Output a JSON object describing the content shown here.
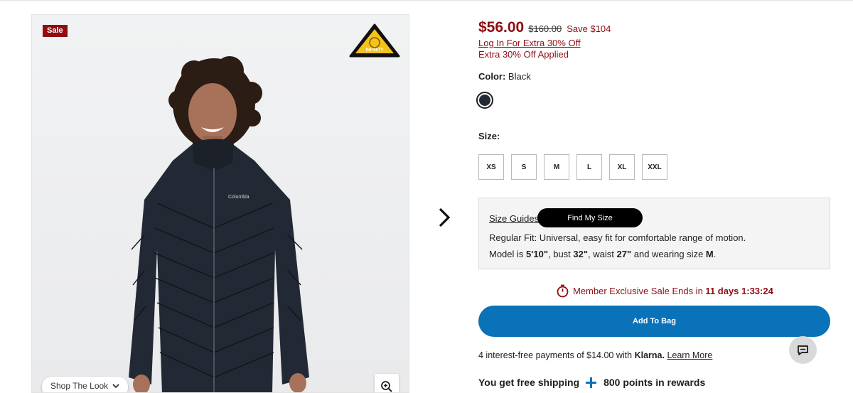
{
  "product_image": {
    "sale_badge": "Sale",
    "tech_badge": "INFINITY",
    "shop_the_look": "Shop The Look",
    "jacket_logo": "Columbia"
  },
  "pricing": {
    "current": "$56.00",
    "original": "$160.00",
    "save": "Save $104",
    "login_offer": "Log In For Extra 30% Off",
    "extra_applied": "Extra 30% Off Applied"
  },
  "color": {
    "label": "Color:",
    "value": "Black",
    "swatch_color": "#232a36"
  },
  "size": {
    "label": "Size:",
    "options": [
      "XS",
      "S",
      "M",
      "L",
      "XL",
      "XXL"
    ]
  },
  "fit": {
    "size_guides": "Size Guides",
    "find_my_size": "Find My Size",
    "regular_fit": "Regular Fit: Universal, easy fit for comfortable range of motion.",
    "model_prefix": "Model is ",
    "model_height": "5'10\"",
    "model_bust_prefix": ", bust ",
    "model_bust": "32\"",
    "model_waist_prefix": ", waist ",
    "model_waist": "27\"",
    "model_size_prefix": " and wearing size ",
    "model_size": "M",
    "model_suffix": "."
  },
  "timer": {
    "text": "Member Exclusive Sale Ends in ",
    "countdown": "11 days 1:33:24"
  },
  "cart": {
    "add_to_bag": "Add To Bag"
  },
  "klarna": {
    "text": "4 interest-free payments of $14.00 with ",
    "brand": "Klarna.",
    "learn_more": "Learn More"
  },
  "perks": {
    "shipping": "You get free shipping",
    "points": "800 points in rewards"
  },
  "colors": {
    "sale_red": "#8e0c12",
    "brand_blue": "#0a72b8"
  }
}
